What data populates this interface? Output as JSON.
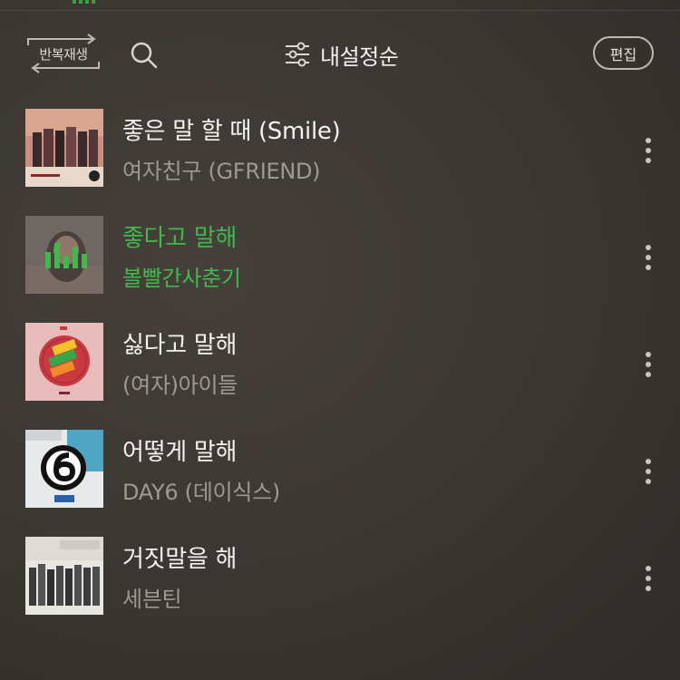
{
  "toolbar": {
    "repeat_label": "반복재생",
    "sort_label": "내설정순",
    "edit_label": "편집"
  },
  "tracks": [
    {
      "title": "좋은 말 할 때 (Smile)",
      "artist": "여자친구 (GFRIEND)",
      "playing": false
    },
    {
      "title": "좋다고 말해",
      "artist": "볼빨간사춘기",
      "playing": true
    },
    {
      "title": "싫다고 말해",
      "artist": "(여자)아이들",
      "playing": false
    },
    {
      "title": "어떻게 말해",
      "artist": "DAY6 (데이식스)",
      "playing": false
    },
    {
      "title": "거짓말을 해",
      "artist": "세븐틴",
      "playing": false
    }
  ],
  "colors": {
    "accent": "#41b84c",
    "background": "#3a3631",
    "secondary_text": "#9d9994"
  }
}
